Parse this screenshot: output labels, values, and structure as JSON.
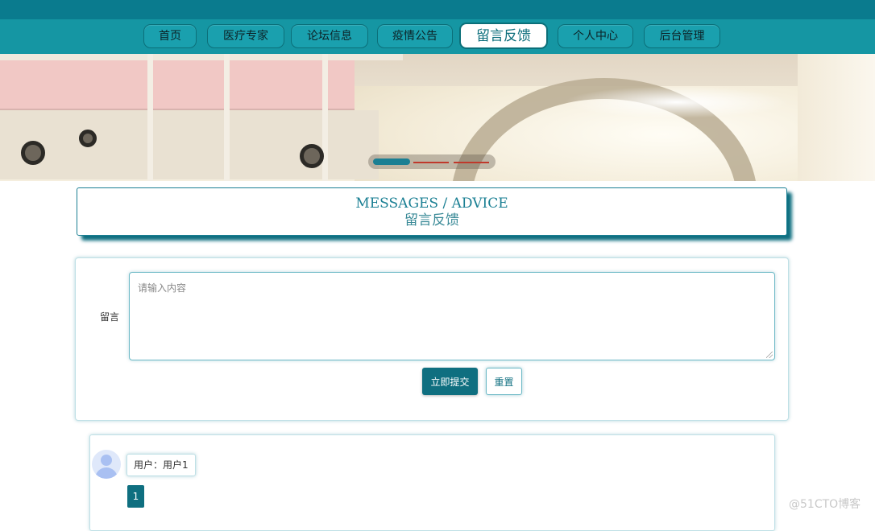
{
  "nav": {
    "items": [
      {
        "label": "首页"
      },
      {
        "label": "医疗专家"
      },
      {
        "label": "论坛信息"
      },
      {
        "label": "疫情公告"
      },
      {
        "label": "留言反馈"
      },
      {
        "label": "个人中心"
      },
      {
        "label": "后台管理"
      }
    ],
    "active_index": 4
  },
  "banner": {
    "slides": 3,
    "active_slide": 1
  },
  "section": {
    "title_en": "MESSAGES / ADVICE",
    "title_cn": "留言反馈"
  },
  "form": {
    "label": "留言",
    "placeholder": "请输入内容",
    "value": "",
    "submit_label": "立即提交",
    "reset_label": "重置"
  },
  "messages": {
    "items": [
      {
        "user": "用户：用户1"
      }
    ],
    "pagination": {
      "current": "1"
    }
  },
  "watermark": "@51CTO博客",
  "colors": {
    "primary": "#0f6f80",
    "nav_bg": "#1596a3",
    "top_strip": "#0a7b8e"
  }
}
